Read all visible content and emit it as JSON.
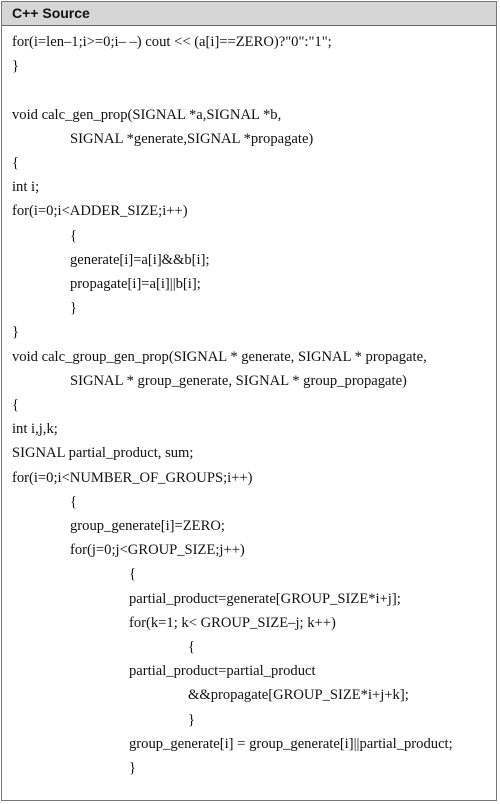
{
  "header": {
    "title": "C++ Source"
  },
  "code": [
    {
      "indent": 0,
      "text": "for(i=len–1;i>=0;i– –) cout << (a[i]==ZERO)?\"0\":\"1\";"
    },
    {
      "indent": 0,
      "text": "}"
    },
    {
      "indent": 0,
      "text": ""
    },
    {
      "indent": 0,
      "text": "void calc_gen_prop(SIGNAL *a,SIGNAL *b,"
    },
    {
      "indent": 1,
      "text": "SIGNAL *generate,SIGNAL *propagate)"
    },
    {
      "indent": 0,
      "text": "{"
    },
    {
      "indent": 0,
      "text": "int i;"
    },
    {
      "indent": 0,
      "text": "for(i=0;i<ADDER_SIZE;i++)"
    },
    {
      "indent": 1,
      "text": "{"
    },
    {
      "indent": 1,
      "text": "generate[i]=a[i]&&b[i];"
    },
    {
      "indent": 1,
      "text": "propagate[i]=a[i]||b[i];"
    },
    {
      "indent": 1,
      "text": "}"
    },
    {
      "indent": 0,
      "text": "}"
    },
    {
      "indent": 0,
      "text": "void calc_group_gen_prop(SIGNAL * generate, SIGNAL * propagate,"
    },
    {
      "indent": 1,
      "text": "SIGNAL * group_generate, SIGNAL * group_propagate)"
    },
    {
      "indent": 0,
      "text": "{"
    },
    {
      "indent": 0,
      "text": "int i,j,k;"
    },
    {
      "indent": 0,
      "text": "SIGNAL partial_product, sum;"
    },
    {
      "indent": 0,
      "text": "for(i=0;i<NUMBER_OF_GROUPS;i++)"
    },
    {
      "indent": 1,
      "text": "{"
    },
    {
      "indent": 1,
      "text": "group_generate[i]=ZERO;"
    },
    {
      "indent": 1,
      "text": "for(j=0;j<GROUP_SIZE;j++)"
    },
    {
      "indent": 2,
      "text": "{"
    },
    {
      "indent": 2,
      "text": "partial_product=generate[GROUP_SIZE*i+j];"
    },
    {
      "indent": 2,
      "text": "for(k=1; k< GROUP_SIZE–j; k++)"
    },
    {
      "indent": 3,
      "text": "{"
    },
    {
      "indent": 2,
      "text": "partial_product=partial_product"
    },
    {
      "indent": 3,
      "text": "&&propagate[GROUP_SIZE*i+j+k];"
    },
    {
      "indent": 3,
      "text": "}"
    },
    {
      "indent": 2,
      "text": "group_generate[i] = group_generate[i]||partial_product;"
    },
    {
      "indent": 2,
      "text": "}"
    }
  ]
}
